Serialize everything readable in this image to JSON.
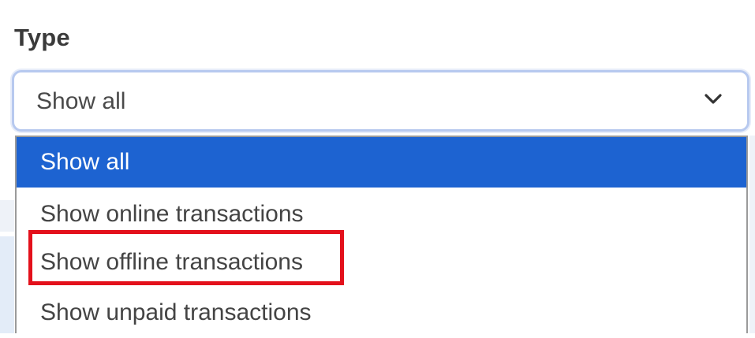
{
  "filter": {
    "label": "Type",
    "selected_value": "Show all",
    "expanded": true,
    "options": [
      {
        "label": "Show all",
        "selected": true
      },
      {
        "label": "Show online transactions",
        "selected": false
      },
      {
        "label": "Show offline transactions",
        "selected": false,
        "annotated": true
      },
      {
        "label": "Show unpaid transactions",
        "selected": false
      }
    ]
  },
  "colors": {
    "selected_option_bg": "#1d63d1",
    "annotation_outline": "#e3101b",
    "focus_border": "#b7c9ef"
  },
  "icons": {
    "select_toggle": "chevron-down-icon"
  }
}
